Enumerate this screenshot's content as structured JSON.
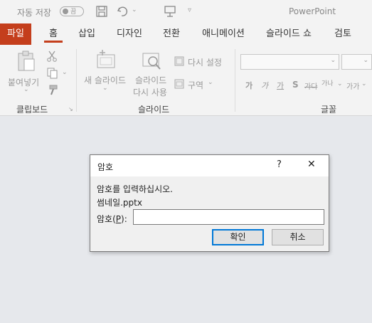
{
  "titlebar": {
    "autosave_label": "자동 저장",
    "autosave_state": "끔",
    "app_title": "PowerPoint"
  },
  "tabs": [
    "파일",
    "홈",
    "삽입",
    "디자인",
    "전환",
    "애니메이션",
    "슬라이드 쇼",
    "검토"
  ],
  "ribbon": {
    "clipboard": {
      "paste_label": "붙여넣기",
      "group_label": "클립보드"
    },
    "slides": {
      "new_slide_label": "새 슬라이드",
      "reuse_slide_line1": "슬라이드",
      "reuse_slide_line2": "다시 사용",
      "reset_label": "다시 설정",
      "section_label": "구역",
      "group_label": "슬라이드"
    },
    "font": {
      "group_label": "글꼴",
      "buttons": [
        "가",
        "가",
        "가",
        "S",
        "가다",
        "가나",
        "가가"
      ]
    }
  },
  "dialog": {
    "title": "암호",
    "help": "?",
    "close": "✕",
    "prompt": "암호를 입력하십시오.",
    "filename": "썸네일.pptx",
    "field_label_prefix": "암호(",
    "field_label_accel": "P",
    "field_label_suffix": "):",
    "password_value": "",
    "ok_label": "확인",
    "cancel_label": "취소"
  },
  "colors": {
    "accent": "#c43e1c",
    "focus_blue": "#0078d7",
    "workspace": "#e6e8ec"
  }
}
